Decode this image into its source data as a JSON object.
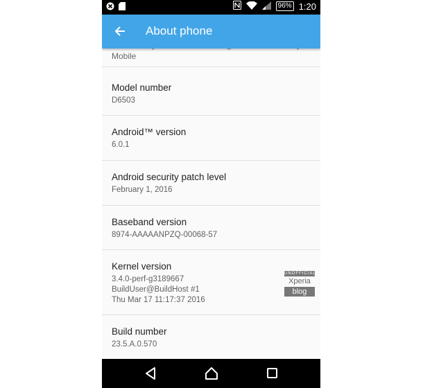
{
  "status_bar": {
    "left_icons": [
      "close-circle-icon",
      "sd-card-icon"
    ],
    "right_icons": [
      "nfc-icon",
      "wifi-icon",
      "signal-icon"
    ],
    "battery": "96%",
    "time": "1:20"
  },
  "app_bar": {
    "title": "About phone",
    "color": "#42a5e8"
  },
  "list": {
    "partial_item_text": "Send anonymous data and usage statistics to Sony Mobile",
    "items": [
      {
        "label": "Model number",
        "value": "D6503"
      },
      {
        "label": "Android™ version",
        "value": "6.0.1"
      },
      {
        "label": "Android security patch level",
        "value": "February 1, 2016"
      },
      {
        "label": "Baseband version",
        "value": "8974-AAAAANPZQ-00068-57"
      },
      {
        "label": "Kernel version",
        "value": "3.4.0-perf-g3189667\nBuildUser@BuildHost #1\nThu Mar 17 11:17:37 2016"
      },
      {
        "label": "Build number",
        "value": "23.5.A.0.570"
      }
    ]
  },
  "watermark": {
    "top": "UNOFFICIAL",
    "middle": "Xperia",
    "bottom": "blog"
  },
  "nav_bar": {
    "icons": [
      "back-triangle-icon",
      "home-circle-icon",
      "recents-square-icon"
    ]
  }
}
